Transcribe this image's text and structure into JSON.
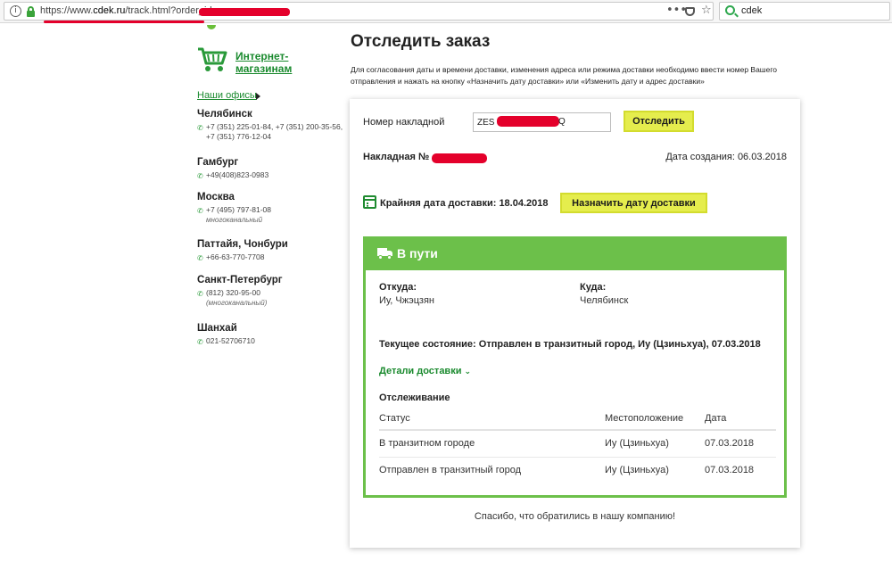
{
  "browser": {
    "url_prefix": "https://www.",
    "url_host": "cdek.ru",
    "url_path": "/track.html?order_id=",
    "search_text": "cdek",
    "more_glyph": "•••",
    "star_glyph": "☆"
  },
  "sidebar": {
    "shop_link": "Интернет-магазинам",
    "offices_link": "Наши офисы",
    "offices": [
      {
        "city": "Челябинск",
        "phone": "+7 (351) 225-01-84, +7 (351) 200-35-56, +7 (351) 776-12-04",
        "note": ""
      },
      {
        "city": "Гамбург",
        "phone": "+49(408)823-0983",
        "note": ""
      },
      {
        "city": "Москва",
        "phone": "+7 (495) 797-81-08",
        "note": "многоканальный"
      },
      {
        "city": "Паттайя, Чонбури",
        "phone": "+66-63-770-7708",
        "note": ""
      },
      {
        "city": "Санкт-Петербург",
        "phone": "(812) 320-95-00",
        "note": "(многоканальный)"
      },
      {
        "city": "Шанхай",
        "phone": "021-52706710",
        "note": ""
      }
    ]
  },
  "main": {
    "title": "Отследить заказ",
    "intro": "Для согласования даты и времени доставки, изменения адреса или режима доставки необходимо ввести номер Вашего отправления и нажать на кнопку «Назначить дату доставки» или «Изменить дату и адрес доставки»",
    "waybill_label": "Номер накладной",
    "waybill_value": "ZES",
    "waybill_tail": "Q",
    "track_button": "Отследить",
    "waybill_no_label": "Накладная №",
    "created_label": "Дата создания:",
    "created_value": "06.03.2018",
    "deadline": "Крайняя дата доставки: 18.04.2018",
    "date_button": "Назначить дату доставки",
    "status": {
      "title": "В пути",
      "from_label": "Откуда:",
      "from_value": "Иу, Чжэцзян",
      "to_label": "Куда:",
      "to_value": "Челябинск",
      "current": "Текущее состояние: Отправлен в транзитный город, Иу (Цзиньхуа), 07.03.2018",
      "details_link": "Детали доставки",
      "details_chevron": "⌄",
      "tracking_title": "Отслеживание",
      "table": {
        "headers": [
          "Статус",
          "Местоположение",
          "Дата"
        ],
        "rows": [
          [
            "В транзитном городе",
            "Иу (Цзиньхуа)",
            "07.03.2018"
          ],
          [
            "Отправлен в транзитный город",
            "Иу (Цзиньхуа)",
            "07.03.2018"
          ]
        ]
      }
    },
    "thanks": "Спасибо, что обратились в нашу компанию!"
  },
  "icons": {
    "phone": "✆",
    "info": "i"
  },
  "colors": {
    "brand_green": "#1a8a2e",
    "status_green": "#6cc04a",
    "button_yellow": "#e5ed4d",
    "redaction_red": "#e4002b"
  }
}
